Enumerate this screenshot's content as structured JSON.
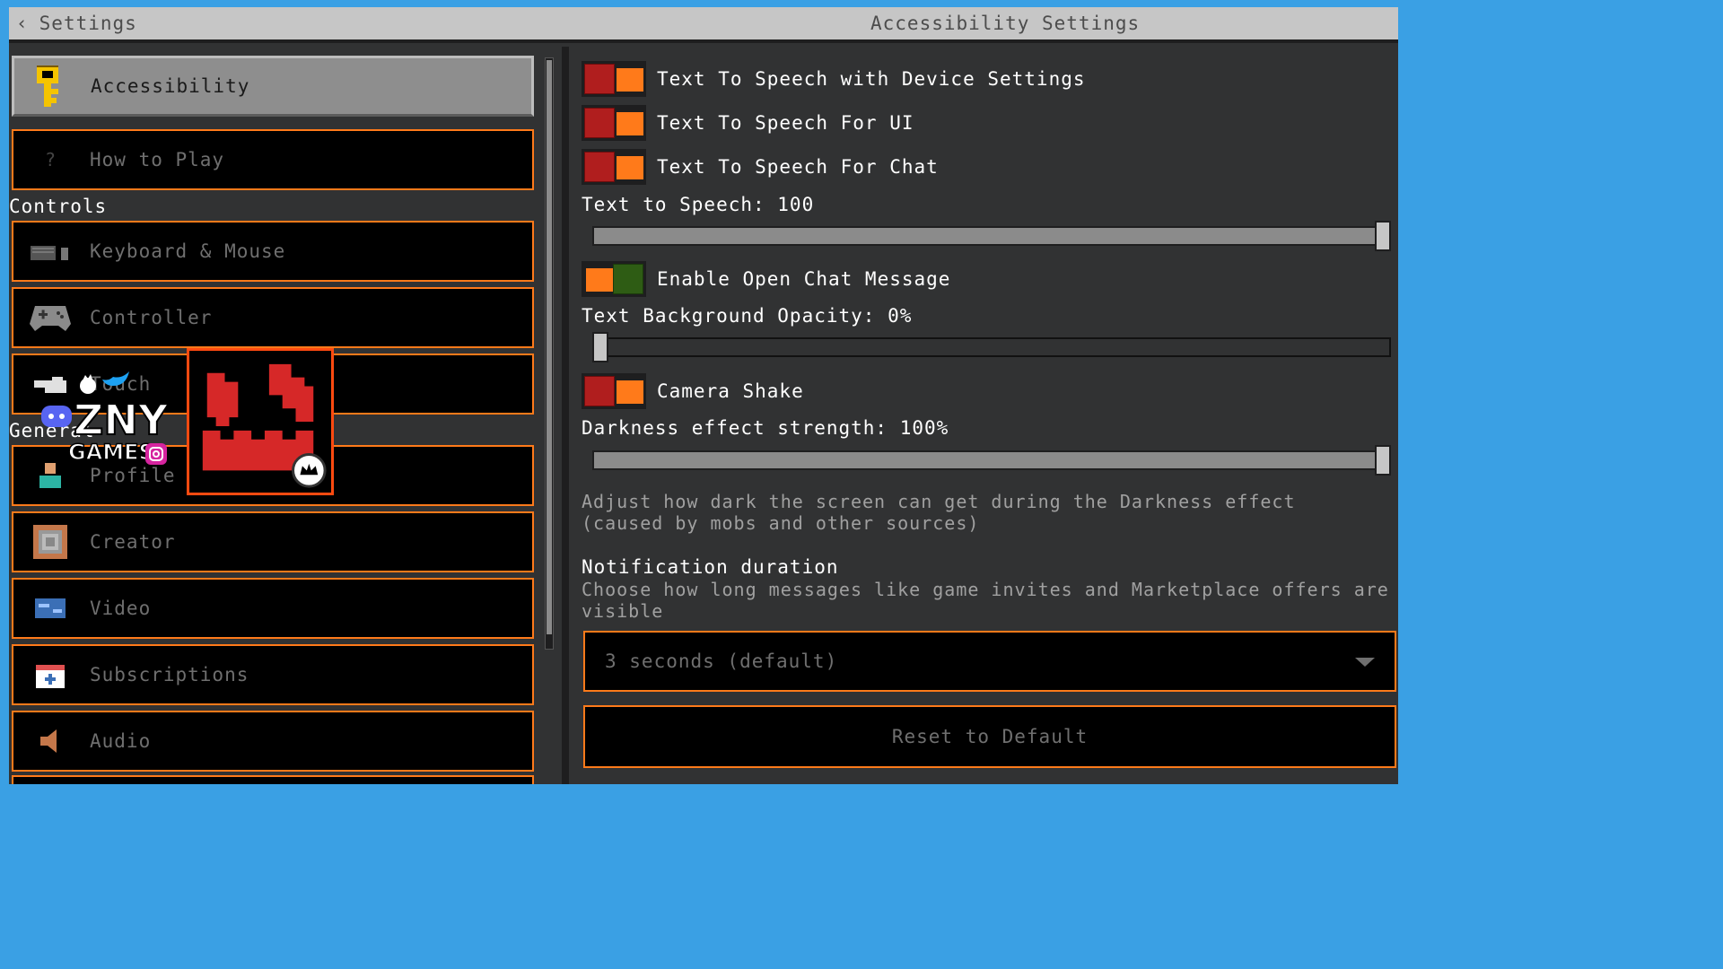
{
  "header": {
    "back_label": "Settings",
    "title": "Accessibility Settings"
  },
  "sidebar": {
    "items_top": [
      {
        "label": "Accessibility",
        "icon": "key-icon",
        "active": true
      },
      {
        "label": "How to Play",
        "icon": "question-icon",
        "active": false
      }
    ],
    "section_controls": "Controls",
    "items_controls": [
      {
        "label": "Keyboard & Mouse",
        "icon": "keyboard-mouse-icon"
      },
      {
        "label": "Controller",
        "icon": "gamepad-icon"
      },
      {
        "label": "Touch",
        "icon": "hand-pointer-icon"
      }
    ],
    "section_general": "General",
    "items_general": [
      {
        "label": "Profile",
        "icon": "profile-icon"
      },
      {
        "label": "Creator",
        "icon": "command-block-icon"
      },
      {
        "label": "Video",
        "icon": "video-icon"
      },
      {
        "label": "Subscriptions",
        "icon": "subscriptions-icon"
      },
      {
        "label": "Audio",
        "icon": "speaker-icon"
      }
    ]
  },
  "settings": {
    "tts_device": {
      "label": "Text To Speech with Device Settings",
      "on": false
    },
    "tts_ui": {
      "label": "Text To Speech For UI",
      "on": false
    },
    "tts_chat": {
      "label": "Text To Speech For Chat",
      "on": false
    },
    "tts_volume": {
      "label": "Text to Speech: 100",
      "value": 100,
      "max": 100
    },
    "open_chat": {
      "label": "Enable Open Chat Message",
      "on": true
    },
    "bg_opacity": {
      "label": "Text Background Opacity: 0%",
      "value": 0,
      "max": 100
    },
    "camera_shake": {
      "label": "Camera Shake",
      "on": false
    },
    "darkness": {
      "label": "Darkness effect strength: 100%",
      "value": 100,
      "max": 100
    },
    "darkness_desc_1": "Adjust how dark the screen can get during the Darkness effect",
    "darkness_desc_2": "(caused by mobs and other sources)",
    "notification_title": "Notification duration",
    "notification_desc_1": "Choose how long messages like game invites and Marketplace offers are",
    "notification_desc_2": "visible",
    "notification_value": "3 seconds (default)",
    "reset_label": "Reset to Default"
  },
  "watermark": {
    "line1": "ZNY",
    "line2": "GAMES"
  },
  "colors": {
    "accent": "#ff7a1a",
    "toggle_off": "#b01e1e",
    "toggle_on": "#2e5c14",
    "background": "#313233",
    "frame": "#3aa0e4"
  }
}
